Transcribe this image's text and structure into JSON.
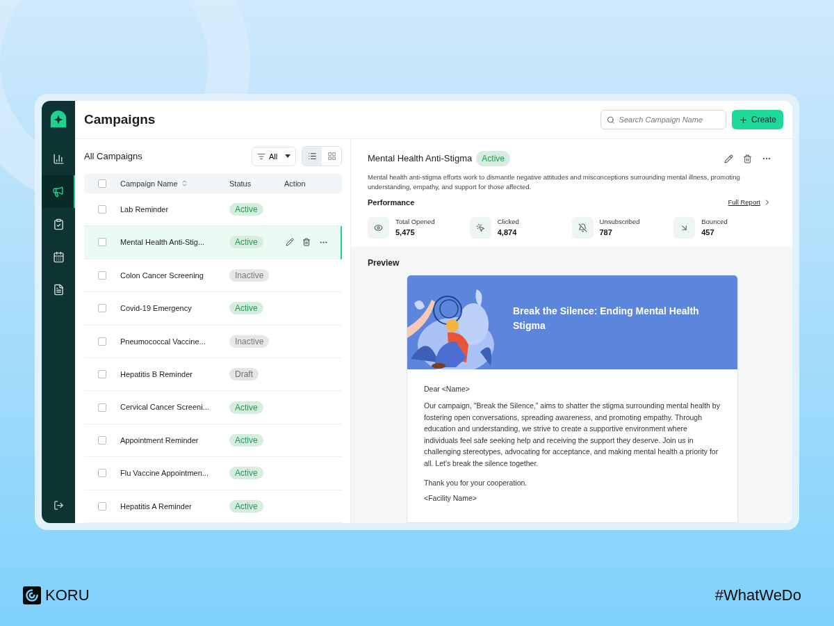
{
  "sidebar": {
    "items": [
      {
        "kind": "chart",
        "selected": false
      },
      {
        "kind": "megaphone",
        "selected": true
      },
      {
        "kind": "checklist",
        "selected": false
      },
      {
        "kind": "calendar",
        "selected": false
      },
      {
        "kind": "document",
        "selected": false
      }
    ]
  },
  "header": {
    "title": "Campaigns",
    "search": {
      "placeholder": "Search Campaign Name"
    },
    "create_button": "Create"
  },
  "list": {
    "title": "All Campaigns",
    "filter": "All",
    "views": [
      {
        "kind": "list",
        "selected": true
      },
      {
        "kind": "grid",
        "selected": false
      }
    ],
    "columns": [
      "Campaign Name",
      "Status",
      "Action"
    ],
    "header_checked": false,
    "rows": [
      {
        "name": "Lab Reminder",
        "status": {
          "text": "Active",
          "color": "#1f9d55"
        },
        "selected": false,
        "checked": false
      },
      {
        "name": "Mental Health Anti-Stig...",
        "status": {
          "text": "Active",
          "color": "#1f9d55"
        },
        "selected": true,
        "checked": false
      },
      {
        "name": "Colon Cancer Screening",
        "status": {
          "text": "Inactive",
          "color": "#7a7a7a"
        },
        "selected": false,
        "checked": false
      },
      {
        "name": "Covid-19 Emergency",
        "status": {
          "text": "Active",
          "color": "#1f9d55"
        },
        "selected": false,
        "checked": false
      },
      {
        "name": "Pneumococcal Vaccine...",
        "status": {
          "text": "Inactive",
          "color": "#7a7a7a"
        },
        "selected": false,
        "checked": false
      },
      {
        "name": "Hepatitis B Reminder",
        "status": {
          "text": "Draft",
          "color": "#6f6f6f"
        },
        "selected": false,
        "checked": false
      },
      {
        "name": "Cervical Cancer Screeni...",
        "status": {
          "text": "Active",
          "color": "#1f9d55"
        },
        "selected": false,
        "checked": false
      },
      {
        "name": "Appointment Reminder",
        "status": {
          "text": "Active",
          "color": "#1f9d55"
        },
        "selected": false,
        "checked": false
      },
      {
        "name": "Flu Vaccine Appointmen...",
        "status": {
          "text": "Active",
          "color": "#1f9d55"
        },
        "selected": false,
        "checked": false
      },
      {
        "name": "Hepatitis A Reminder",
        "status": {
          "text": "Active",
          "color": "#1f9d55"
        },
        "selected": false,
        "checked": false
      }
    ]
  },
  "detail": {
    "title": "Mental Health Anti-Stigma",
    "status": {
      "text": "Active",
      "color": "#1f9d55"
    },
    "description": "Mental health anti-stigma efforts work to dismantle negative attitudes and misconceptions surrounding mental illness, promoting understanding, empathy, and support for those affected.",
    "performance_title": "Performance",
    "full_report": "Full Report",
    "metrics": [
      {
        "kind": "eye",
        "label": "Total Opened",
        "value": "5,475"
      },
      {
        "kind": "click",
        "label": "Clicked",
        "value": "4,874"
      },
      {
        "kind": "bell-off",
        "label": "Unsubscribed",
        "value": "787"
      },
      {
        "kind": "bounce",
        "label": "Bounced",
        "value": "457"
      }
    ]
  },
  "preview": {
    "title": "Preview",
    "banner_title": "Break the Silence: Ending Mental Health Stigma",
    "greeting": "Dear <Name>",
    "body": "Our campaign, \"Break the Silence,\" aims to shatter the stigma surrounding mental health by fostering open conversations, spreading awareness, and promoting empathy. Through education and understanding, we strive to create a supportive environment where individuals feel safe seeking help and receiving the support they deserve. Join us in challenging stereotypes, advocating for acceptance, and making mental health a priority for all. Let's break the silence together.",
    "closing": [
      "Thank you for your cooperation.",
      "<Facility Name>"
    ]
  },
  "brand": {
    "name": "KORU",
    "hashtag": "#WhatWeDo"
  }
}
